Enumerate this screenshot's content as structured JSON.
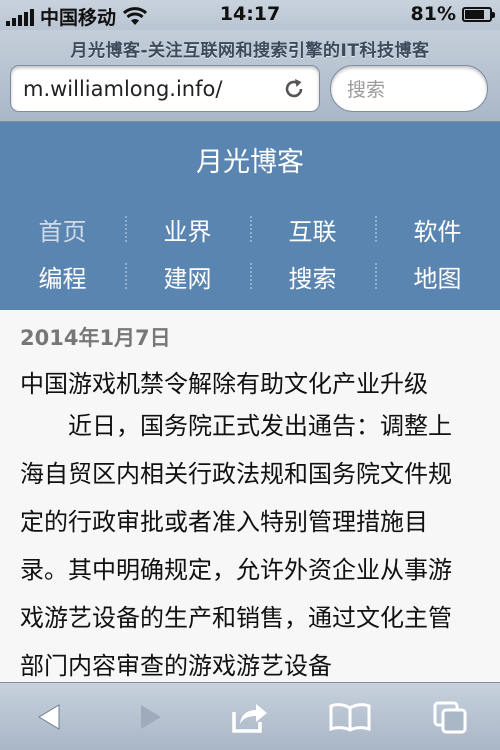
{
  "status_bar": {
    "carrier": "中国移动",
    "time": "14:17",
    "battery": "81%",
    "battery_level": 0.81
  },
  "browser": {
    "page_title": "月光博客-关注互联网和搜索引擎的IT科技博客",
    "url": "m.williamlong.info/",
    "search_placeholder": "搜索"
  },
  "site": {
    "title": "月光博客",
    "nav": [
      {
        "label": "首页"
      },
      {
        "label": "业界"
      },
      {
        "label": "互联"
      },
      {
        "label": "软件"
      },
      {
        "label": "编程"
      },
      {
        "label": "建网"
      },
      {
        "label": "搜索"
      },
      {
        "label": "地图"
      }
    ]
  },
  "article": {
    "date": "2014年1月7日",
    "title": "中国游戏机禁令解除有助文化产业升级",
    "body": "近日，国务院正式发出通告：调整上海自贸区内相关行政法规和国务院文件规定的行政审批或者准入特别管理措施目录。其中明确规定，允许外资企业从事游戏游艺设备的生产和销售，通过文化主管部门内容审查的游戏游艺设备"
  },
  "toolbar": {
    "icons": [
      "back-icon",
      "forward-icon",
      "share-icon",
      "bookmarks-icon",
      "tabs-icon"
    ]
  }
}
